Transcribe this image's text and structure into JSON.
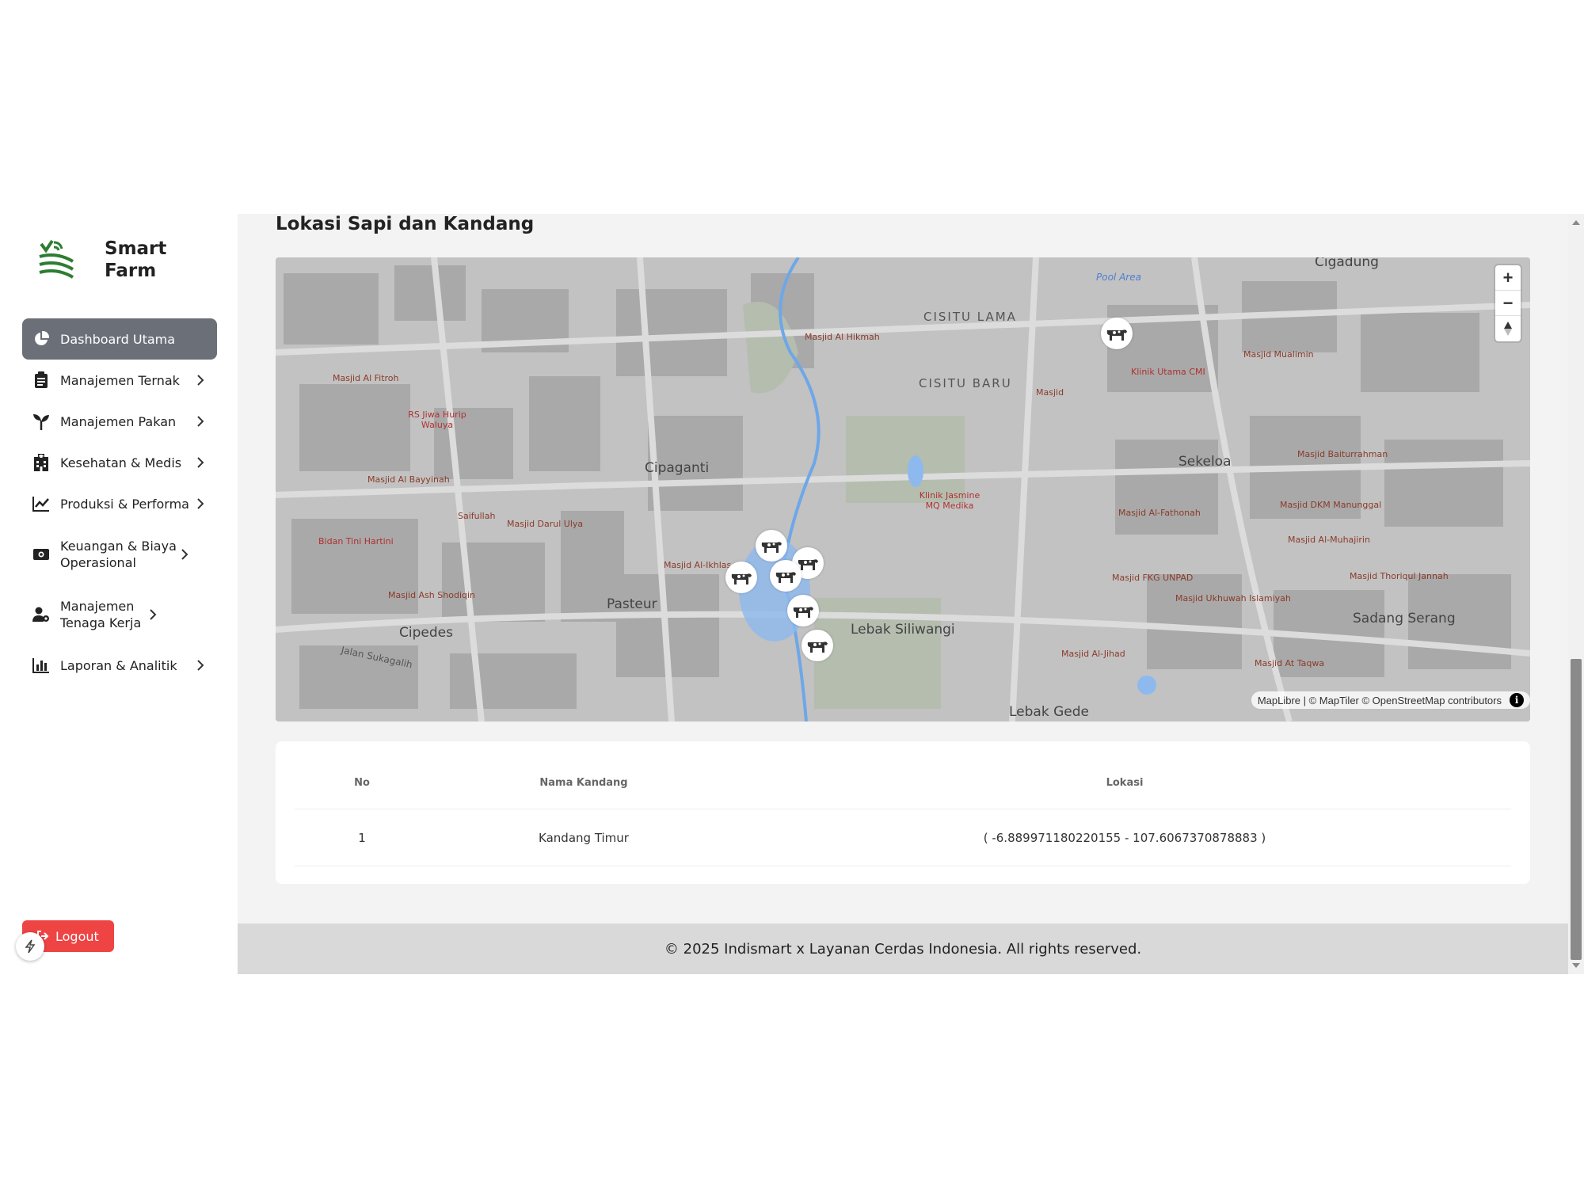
{
  "brand": {
    "line1": "Smart",
    "line2": "Farm"
  },
  "sidebar": {
    "items": [
      {
        "label": "Dashboard Utama",
        "icon": "pie-chart-icon",
        "active": true
      },
      {
        "label": "Manajemen Ternak",
        "icon": "clipboard-icon"
      },
      {
        "label": "Manajemen Pakan",
        "icon": "seedling-icon"
      },
      {
        "label": "Kesehatan & Medis",
        "icon": "hospital-icon"
      },
      {
        "label": "Produksi & Performa",
        "icon": "line-chart-icon"
      },
      {
        "label": "Keuangan & Biaya Operasional",
        "icon": "money-icon"
      },
      {
        "label": "Manajemen Tenaga Kerja",
        "icon": "user-gear-icon"
      },
      {
        "label": "Laporan & Analitik",
        "icon": "bar-chart-icon"
      }
    ],
    "logout_label": "Logout"
  },
  "main": {
    "title": "Lokasi Sapi dan Kandang",
    "map": {
      "places": [
        "Cigadung",
        "Cipaganti",
        "Sekeloa",
        "Pasteur",
        "Cipedes",
        "Lebak Siliwangi",
        "Sadang Serang",
        "Lebak Gede"
      ],
      "districts": [
        "CISITU LAMA",
        "CISITU BARU"
      ],
      "pois": [
        "Masjid Al Hikmah",
        "Masjid Al Fitroh",
        "Masjid Al Bayyinah",
        "Saifullah",
        "Masjid Darul Ulya",
        "Masjid Al-Ikhlas",
        "Masjid Ash Shodiqin",
        "Masjid Mualimin",
        "Masjid",
        "Masjid Baiturrahman",
        "Masjid DKM Manunggal",
        "Masjid Al-Fathonah",
        "Masjid Al-Muhajirin",
        "Masjid Thoriqul Jannah",
        "Masjid FKG UNPAD",
        "Masjid Ukhuwah Islamiyah",
        "Masjid Al-Jihad",
        "Masjid At Taqwa"
      ],
      "hospitals": [
        "RS Jiwa Hurip Waluya",
        "Bidan Tini Hartini",
        "Klinik Utama CMI",
        "Klinik Jasmine MQ Medika"
      ],
      "water": "Pool Area",
      "road": "Jalan Sukagalih",
      "attribution": "MapLibre | © MapTiler © OpenStreetMap contributors",
      "zoom_in": "+",
      "zoom_out": "−"
    },
    "table": {
      "headers": {
        "no": "No",
        "name": "Nama Kandang",
        "location": "Lokasi"
      },
      "rows": [
        {
          "no": "1",
          "name": "Kandang Timur",
          "location": "( -6.889971180220155 - 107.6067370878883 )"
        }
      ]
    }
  },
  "footer": {
    "text": "© 2025 Indismart x Layanan Cerdas Indonesia. All rights reserved."
  },
  "colors": {
    "active_menu": "#6b6f78",
    "logout": "#ef4444",
    "brand_green": "#2e7d32",
    "footer": "#d9d9d9"
  }
}
